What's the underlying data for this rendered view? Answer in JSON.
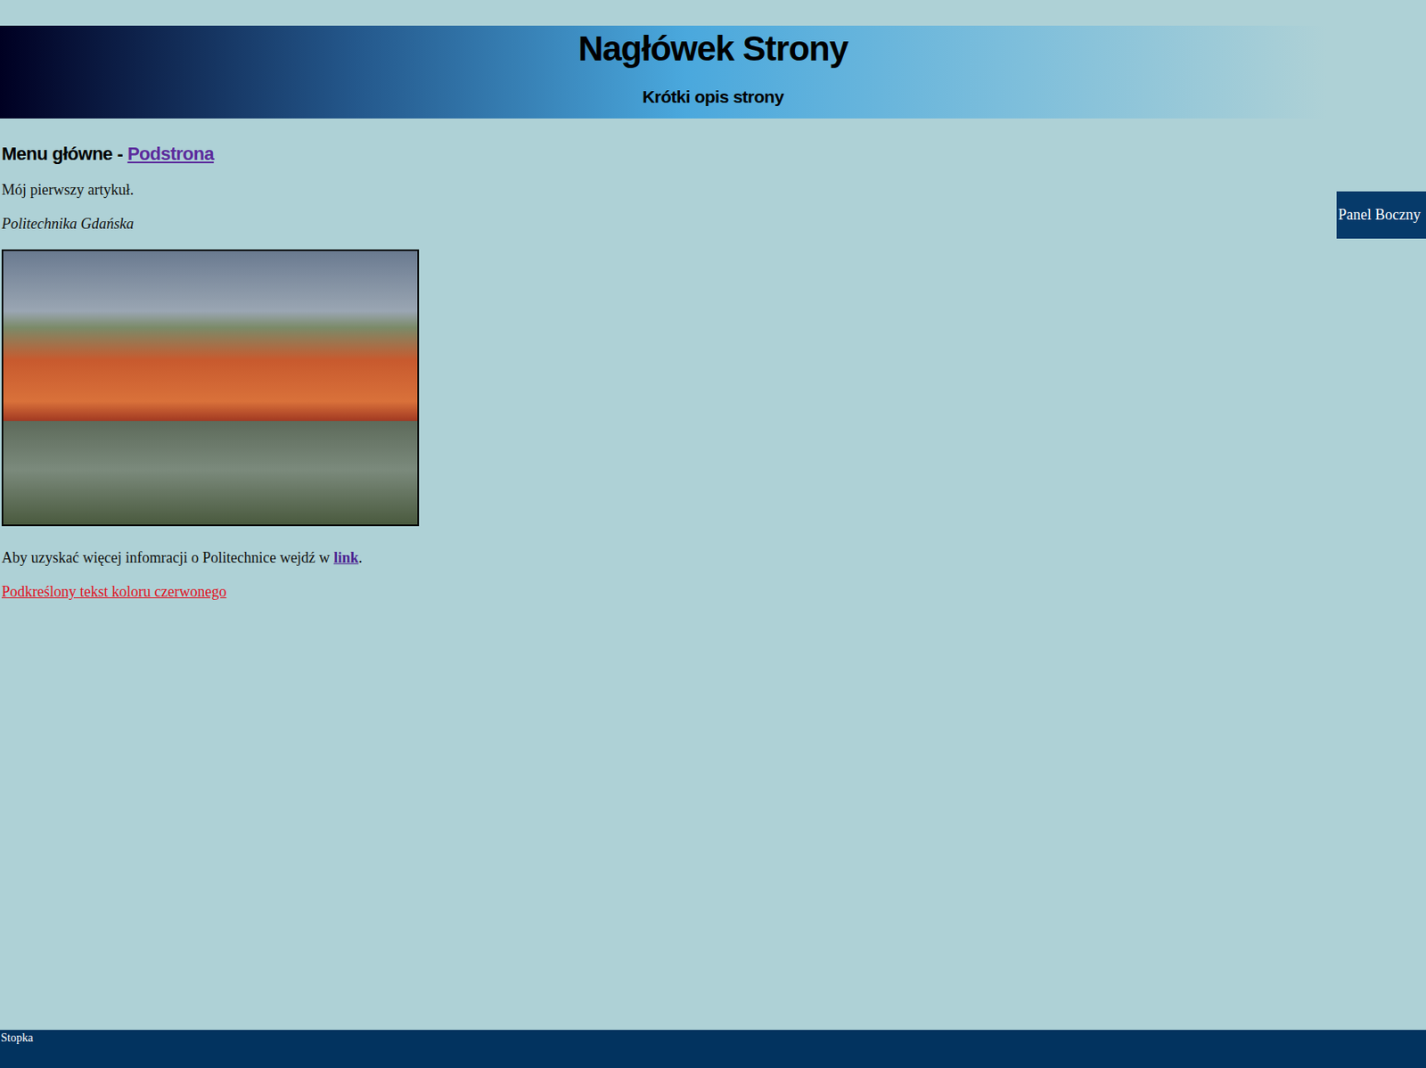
{
  "header": {
    "title": "Nagłówek Strony",
    "subtitle": "Krótki opis strony"
  },
  "menu": {
    "label": "Menu główne - ",
    "link": "Podstrona"
  },
  "article": {
    "intro": "Mój pierwszy artykuł.",
    "caption": "Politechnika Gdańska",
    "more": {
      "before": "Aby uzyskać więcej infomracji o Politechnice wejdź w ",
      "link": "link",
      "after": "."
    },
    "red_text": "Podkreślony tekst koloru czerwonego"
  },
  "sidebar": {
    "title": "Panel Boczny"
  },
  "footer": {
    "text": "Stopka"
  }
}
